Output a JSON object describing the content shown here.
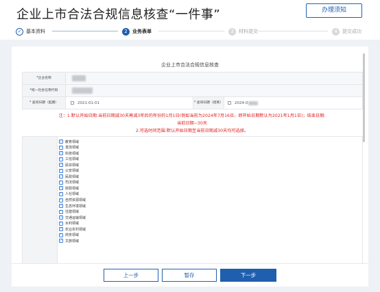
{
  "header": {
    "title": "企业上市合法合规信息核查“一件事”",
    "guide_button": "办理须知"
  },
  "steps": [
    {
      "index": "✓",
      "label": "基本资料",
      "state": "done"
    },
    {
      "index": "2",
      "label": "业务表单",
      "state": "active"
    },
    {
      "index": "3",
      "label": "材料提交",
      "state": "todo"
    },
    {
      "index": "4",
      "label": "提交成功",
      "state": "todo"
    }
  ],
  "form": {
    "title": "企业上市合法合规信息核查",
    "company_name_label": "*企业名称",
    "credit_code_label": "*统一社会信用代码",
    "query_start_label": "* 查询日期（起期）",
    "query_start_value": "2021-01-01",
    "query_end_label": "* 查询日期（结束）",
    "query_end_value": "2024-0"
  },
  "notes": {
    "line1": "注：1.默认开始日期:当前日期减30天再减3年后的年份的1月1日(例如当前为2024年7月16日，即开始日期默认为2021年1月1日)；结束日期:",
    "line2": "当前日期−30天",
    "line3": "2.可选时间范围:默认开始日期至当前日期减30天均可选择。"
  },
  "domains": [
    "教育领域",
    "发改领域",
    "科技领域",
    "工信领域",
    "民宗领域",
    "公安领域",
    "民政领域",
    "司法领域",
    "财政领域",
    "人社领域",
    "自然资源领域",
    "生态环境领域",
    "住建领域",
    "交通运输领域",
    "水利领域",
    "农业农村领域",
    "商务领域",
    "文旅领域"
  ],
  "footer": {
    "prev": "上一步",
    "save": "暂存",
    "next": "下一步"
  },
  "colors": {
    "primary": "#1f5fae",
    "required": "#e02020",
    "background": "#eef1f5"
  }
}
